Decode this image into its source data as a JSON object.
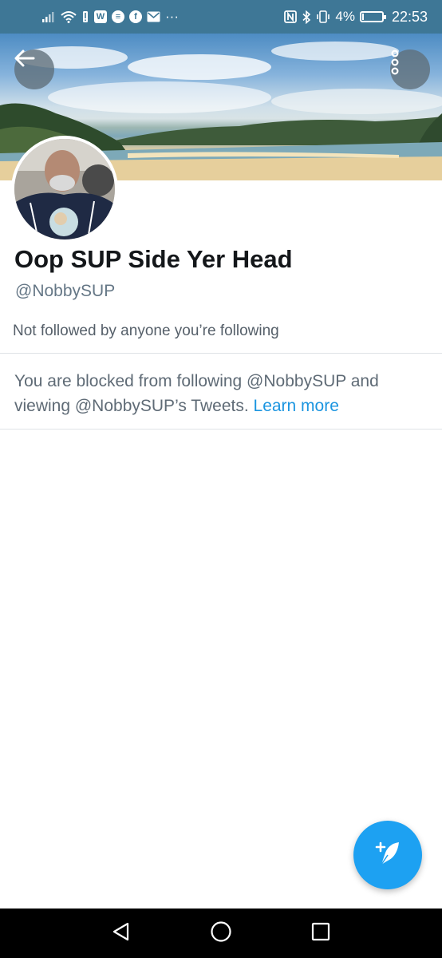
{
  "status_bar": {
    "notification_icons": [
      "signal-icon",
      "wifi-icon",
      "alert-icon",
      "w-app-icon",
      "sync-icon",
      "facebook-icon",
      "mail-icon"
    ],
    "more_glyph": "···",
    "right_icons": [
      "nfc-icon",
      "bluetooth-icon",
      "vibrate-icon"
    ],
    "battery_percent": "4%",
    "battery_level": 0.04,
    "time": "22:53",
    "background_color": "#3e7796"
  },
  "header": {
    "back_icon": "arrow-left-icon",
    "more_icon": "more-vertical-icon"
  },
  "profile": {
    "display_name": "Oop SUP Side Yer Head",
    "handle": "@NobbySUP",
    "followed_by_text": "Not followed by anyone you’re following",
    "blocked_message": "You are blocked from following @NobbySUP and viewing @NobbySUP’s Tweets.",
    "learn_more_label": "Learn more"
  },
  "compose": {
    "icon": "compose-tweet-icon",
    "color": "#1da1f2"
  },
  "nav_bar": {
    "back_icon": "triangle-back-icon",
    "home_icon": "circle-home-icon",
    "recents_icon": "square-recents-icon"
  },
  "colors": {
    "link": "#1b95e0",
    "text_secondary": "#657786"
  }
}
